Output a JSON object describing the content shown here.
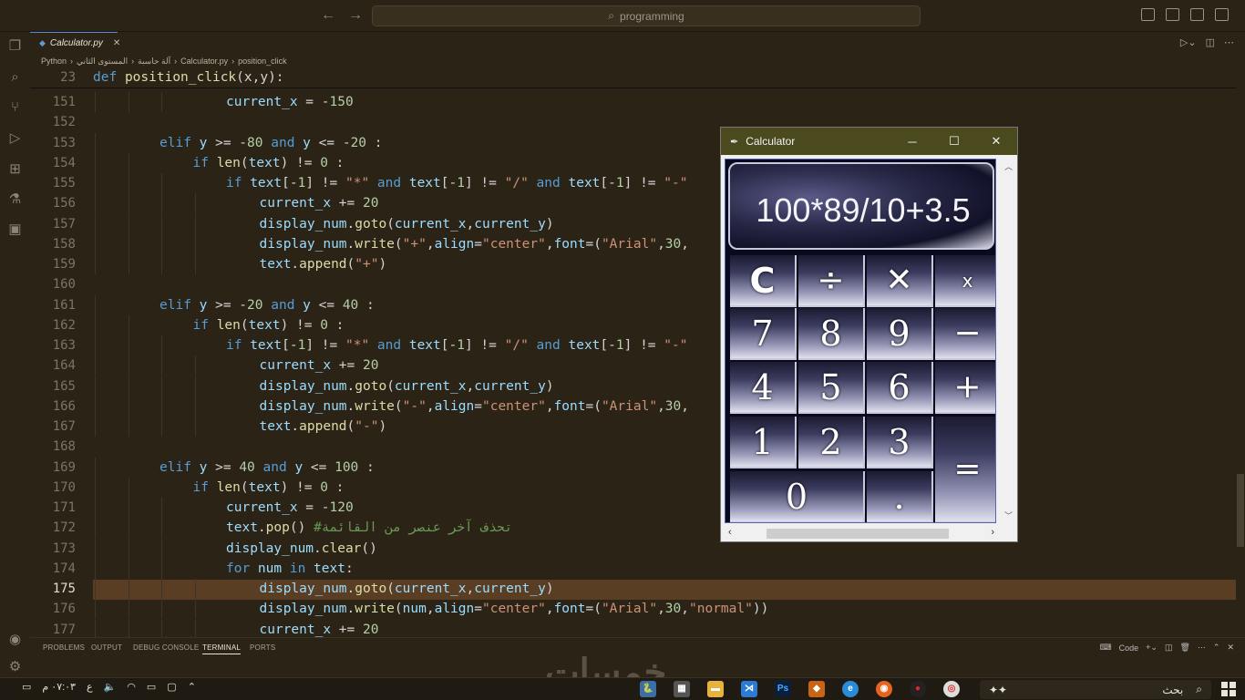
{
  "titlebar": {
    "search_text": "programming"
  },
  "tab": {
    "filename": "Calculator.py",
    "icon": "python-icon"
  },
  "breadcrumb": [
    "Python",
    "المستوى الثاني",
    "آلة حاسبة",
    "Calculator.py",
    "position_click"
  ],
  "sticky": {
    "line_no": "23",
    "kw": "def",
    "fn": "position_click",
    "rest": "(x,y):"
  },
  "lines": [
    {
      "n": "151",
      "indent": 4,
      "html": [
        [
          "var",
          "current_x"
        ],
        [
          "op",
          " = -"
        ],
        [
          "num",
          "150"
        ]
      ]
    },
    {
      "n": "152",
      "indent": 0,
      "html": []
    },
    {
      "n": "153",
      "indent": 2,
      "html": [
        [
          "kw",
          "elif "
        ],
        [
          "var",
          "y"
        ],
        [
          "op",
          " >= -"
        ],
        [
          "num",
          "80"
        ],
        [
          "kw",
          " and "
        ],
        [
          "var",
          "y"
        ],
        [
          "op",
          " <= -"
        ],
        [
          "num",
          "20"
        ],
        [
          "op",
          " :"
        ]
      ]
    },
    {
      "n": "154",
      "indent": 3,
      "html": [
        [
          "kw",
          "if "
        ],
        [
          "fn",
          "len"
        ],
        [
          "op",
          "("
        ],
        [
          "var",
          "text"
        ],
        [
          "op",
          ") != "
        ],
        [
          "num",
          "0"
        ],
        [
          "op",
          " :"
        ]
      ]
    },
    {
      "n": "155",
      "indent": 4,
      "html": [
        [
          "kw",
          "if "
        ],
        [
          "var",
          "text"
        ],
        [
          "op",
          "[-"
        ],
        [
          "num",
          "1"
        ],
        [
          "op",
          "] != "
        ],
        [
          "str",
          "\"*\""
        ],
        [
          "kw",
          " and "
        ],
        [
          "var",
          "text"
        ],
        [
          "op",
          "[-"
        ],
        [
          "num",
          "1"
        ],
        [
          "op",
          "] != "
        ],
        [
          "str",
          "\"/\""
        ],
        [
          "kw",
          " and "
        ],
        [
          "var",
          "text"
        ],
        [
          "op",
          "[-"
        ],
        [
          "num",
          "1"
        ],
        [
          "op",
          "] != "
        ],
        [
          "str",
          "\"-\""
        ],
        [
          "op",
          "                                   "
        ],
        [
          "str",
          "\".\""
        ],
        [
          "op",
          ":"
        ]
      ]
    },
    {
      "n": "156",
      "indent": 5,
      "html": [
        [
          "var",
          "current_x"
        ],
        [
          "op",
          " += "
        ],
        [
          "num",
          "20"
        ]
      ]
    },
    {
      "n": "157",
      "indent": 5,
      "html": [
        [
          "var",
          "display_num"
        ],
        [
          "op",
          "."
        ],
        [
          "fn",
          "goto"
        ],
        [
          "op",
          "("
        ],
        [
          "var",
          "current_x"
        ],
        [
          "op",
          ","
        ],
        [
          "var",
          "current_y"
        ],
        [
          "op",
          ")"
        ]
      ]
    },
    {
      "n": "158",
      "indent": 5,
      "html": [
        [
          "var",
          "display_num"
        ],
        [
          "op",
          "."
        ],
        [
          "fn",
          "write"
        ],
        [
          "op",
          "("
        ],
        [
          "str",
          "\"+\""
        ],
        [
          "op",
          ","
        ],
        [
          "var",
          "align"
        ],
        [
          "op",
          "="
        ],
        [
          "str",
          "\"center\""
        ],
        [
          "op",
          ","
        ],
        [
          "var",
          "font"
        ],
        [
          "op",
          "=("
        ],
        [
          "str",
          "\"Arial\""
        ],
        [
          "op",
          ","
        ],
        [
          "num",
          "30"
        ],
        [
          "op",
          ","
        ]
      ]
    },
    {
      "n": "159",
      "indent": 5,
      "html": [
        [
          "var",
          "text"
        ],
        [
          "op",
          "."
        ],
        [
          "fn",
          "append"
        ],
        [
          "op",
          "("
        ],
        [
          "str",
          "\"+\""
        ],
        [
          "op",
          ")"
        ]
      ]
    },
    {
      "n": "160",
      "indent": 0,
      "html": []
    },
    {
      "n": "161",
      "indent": 2,
      "html": [
        [
          "kw",
          "elif "
        ],
        [
          "var",
          "y"
        ],
        [
          "op",
          " >= -"
        ],
        [
          "num",
          "20"
        ],
        [
          "kw",
          " and "
        ],
        [
          "var",
          "y"
        ],
        [
          "op",
          " <= "
        ],
        [
          "num",
          "40"
        ],
        [
          "op",
          " :"
        ]
      ]
    },
    {
      "n": "162",
      "indent": 3,
      "html": [
        [
          "kw",
          "if "
        ],
        [
          "fn",
          "len"
        ],
        [
          "op",
          "("
        ],
        [
          "var",
          "text"
        ],
        [
          "op",
          ") != "
        ],
        [
          "num",
          "0"
        ],
        [
          "op",
          " :"
        ]
      ]
    },
    {
      "n": "163",
      "indent": 4,
      "html": [
        [
          "kw",
          "if "
        ],
        [
          "var",
          "text"
        ],
        [
          "op",
          "[-"
        ],
        [
          "num",
          "1"
        ],
        [
          "op",
          "] != "
        ],
        [
          "str",
          "\"*\""
        ],
        [
          "kw",
          " and "
        ],
        [
          "var",
          "text"
        ],
        [
          "op",
          "[-"
        ],
        [
          "num",
          "1"
        ],
        [
          "op",
          "] != "
        ],
        [
          "str",
          "\"/\""
        ],
        [
          "kw",
          " and "
        ],
        [
          "var",
          "text"
        ],
        [
          "op",
          "[-"
        ],
        [
          "num",
          "1"
        ],
        [
          "op",
          "] != "
        ],
        [
          "str",
          "\"-\""
        ],
        [
          "op",
          "                                   "
        ],
        [
          "str",
          "\".\""
        ],
        [
          "op",
          ":"
        ]
      ]
    },
    {
      "n": "164",
      "indent": 5,
      "html": [
        [
          "var",
          "current_x"
        ],
        [
          "op",
          " += "
        ],
        [
          "num",
          "20"
        ]
      ]
    },
    {
      "n": "165",
      "indent": 5,
      "html": [
        [
          "var",
          "display_num"
        ],
        [
          "op",
          "."
        ],
        [
          "fn",
          "goto"
        ],
        [
          "op",
          "("
        ],
        [
          "var",
          "current_x"
        ],
        [
          "op",
          ","
        ],
        [
          "var",
          "current_y"
        ],
        [
          "op",
          ")"
        ]
      ]
    },
    {
      "n": "166",
      "indent": 5,
      "html": [
        [
          "var",
          "display_num"
        ],
        [
          "op",
          "."
        ],
        [
          "fn",
          "write"
        ],
        [
          "op",
          "("
        ],
        [
          "str",
          "\"-\""
        ],
        [
          "op",
          ","
        ],
        [
          "var",
          "align"
        ],
        [
          "op",
          "="
        ],
        [
          "str",
          "\"center\""
        ],
        [
          "op",
          ","
        ],
        [
          "var",
          "font"
        ],
        [
          "op",
          "=("
        ],
        [
          "str",
          "\"Arial\""
        ],
        [
          "op",
          ","
        ],
        [
          "num",
          "30"
        ],
        [
          "op",
          ","
        ]
      ]
    },
    {
      "n": "167",
      "indent": 5,
      "html": [
        [
          "var",
          "text"
        ],
        [
          "op",
          "."
        ],
        [
          "fn",
          "append"
        ],
        [
          "op",
          "("
        ],
        [
          "str",
          "\"-\""
        ],
        [
          "op",
          ")"
        ]
      ]
    },
    {
      "n": "168",
      "indent": 0,
      "html": []
    },
    {
      "n": "169",
      "indent": 2,
      "html": [
        [
          "kw",
          "elif "
        ],
        [
          "var",
          "y"
        ],
        [
          "op",
          " >= "
        ],
        [
          "num",
          "40"
        ],
        [
          "kw",
          " and "
        ],
        [
          "var",
          "y"
        ],
        [
          "op",
          " <= "
        ],
        [
          "num",
          "100"
        ],
        [
          "op",
          " :"
        ]
      ]
    },
    {
      "n": "170",
      "indent": 3,
      "html": [
        [
          "kw",
          "if "
        ],
        [
          "fn",
          "len"
        ],
        [
          "op",
          "("
        ],
        [
          "var",
          "text"
        ],
        [
          "op",
          ") != "
        ],
        [
          "num",
          "0"
        ],
        [
          "op",
          " :"
        ]
      ]
    },
    {
      "n": "171",
      "indent": 4,
      "html": [
        [
          "var",
          "current_x"
        ],
        [
          "op",
          " = -"
        ],
        [
          "num",
          "120"
        ]
      ]
    },
    {
      "n": "172",
      "indent": 4,
      "html": [
        [
          "var",
          "text"
        ],
        [
          "op",
          "."
        ],
        [
          "fn",
          "pop"
        ],
        [
          "op",
          "() "
        ],
        [
          "cm",
          "#تحذف آخر عنصر من القائمة"
        ]
      ]
    },
    {
      "n": "173",
      "indent": 4,
      "html": [
        [
          "var",
          "display_num"
        ],
        [
          "op",
          "."
        ],
        [
          "fn",
          "clear"
        ],
        [
          "op",
          "()"
        ]
      ]
    },
    {
      "n": "174",
      "indent": 4,
      "html": [
        [
          "kw",
          "for "
        ],
        [
          "var",
          "num"
        ],
        [
          "kw",
          " in "
        ],
        [
          "var",
          "text"
        ],
        [
          "op",
          ":"
        ]
      ]
    },
    {
      "n": "175",
      "indent": 5,
      "html": [
        [
          "var",
          "display_num"
        ],
        [
          "op",
          "."
        ],
        [
          "fn",
          "goto"
        ],
        [
          "op",
          "("
        ],
        [
          "var",
          "current_x"
        ],
        [
          "op",
          ","
        ],
        [
          "var",
          "current_y"
        ],
        [
          "op",
          ")"
        ]
      ]
    },
    {
      "n": "176",
      "indent": 5,
      "html": [
        [
          "var",
          "display_num"
        ],
        [
          "op",
          "."
        ],
        [
          "fn",
          "write"
        ],
        [
          "op",
          "("
        ],
        [
          "var",
          "num"
        ],
        [
          "op",
          ","
        ],
        [
          "var",
          "align"
        ],
        [
          "op",
          "="
        ],
        [
          "str",
          "\"center\""
        ],
        [
          "op",
          ","
        ],
        [
          "var",
          "font"
        ],
        [
          "op",
          "=("
        ],
        [
          "str",
          "\"Arial\""
        ],
        [
          "op",
          ","
        ],
        [
          "num",
          "30"
        ],
        [
          "op",
          ","
        ],
        [
          "str",
          "\"normal\""
        ],
        [
          "op",
          "))"
        ]
      ]
    },
    {
      "n": "177",
      "indent": 5,
      "html": [
        [
          "var",
          "current_x"
        ],
        [
          "op",
          " += "
        ],
        [
          "num",
          "20"
        ]
      ]
    }
  ],
  "active_line": "175",
  "panel": {
    "tabs": [
      "PROBLEMS",
      "OUTPUT",
      "DEBUG CONSOLE",
      "TERMINAL",
      "PORTS"
    ],
    "active": "TERMINAL",
    "terminal_name": "Code"
  },
  "calculator": {
    "title": "Calculator",
    "display": "100*89/10+3.5",
    "keys": [
      {
        "label": "C",
        "name": "clear-key"
      },
      {
        "label": "÷",
        "name": "divide-key"
      },
      {
        "label": "✕",
        "name": "multiply-key"
      },
      {
        "label": "x",
        "name": "backspace-key"
      },
      {
        "label": "7",
        "name": "seven-key"
      },
      {
        "label": "8",
        "name": "eight-key"
      },
      {
        "label": "9",
        "name": "nine-key"
      },
      {
        "label": "−",
        "name": "minus-key"
      },
      {
        "label": "4",
        "name": "four-key"
      },
      {
        "label": "5",
        "name": "five-key"
      },
      {
        "label": "6",
        "name": "six-key"
      },
      {
        "label": "+",
        "name": "plus-key"
      },
      {
        "label": "1",
        "name": "one-key"
      },
      {
        "label": "2",
        "name": "two-key"
      },
      {
        "label": "3",
        "name": "three-key"
      },
      {
        "label": "=",
        "name": "equals-key"
      },
      {
        "label": "0",
        "name": "zero-key"
      },
      {
        "label": ".",
        "name": "dot-key"
      }
    ]
  },
  "taskbar": {
    "time": "٠٧:٠٣ م",
    "lang": "ع",
    "search_placeholder": "بحث",
    "watermark": "خمسات"
  }
}
